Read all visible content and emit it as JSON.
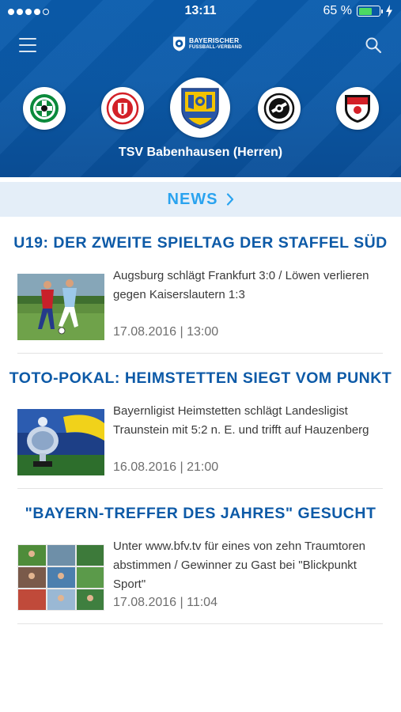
{
  "status_bar": {
    "time": "13:11",
    "battery_text": "65 %",
    "battery_level": 0.65,
    "signal_dots": 5,
    "signal_filled": 4
  },
  "header": {
    "logo_line1": "BAYERISCHER",
    "logo_line2": "FUSSBALL-VERBAND",
    "menu_icon": "hamburger-menu-icon",
    "search_icon": "search-icon",
    "selected_team": "TSV Babenhausen (Herren)",
    "colors": {
      "background": "#0a56a3",
      "text": "#ffffff"
    }
  },
  "club_crests": [
    {
      "icon": "green-club-crest-icon",
      "colors": [
        "#0b8a3b",
        "#ffffff"
      ]
    },
    {
      "icon": "red-club-crest-icon",
      "colors": [
        "#d32027",
        "#ffffff"
      ]
    },
    {
      "icon": "tsv-babenhausen-crest-icon",
      "colors": [
        "#2a56a7",
        "#f3c300"
      ],
      "selected": true
    },
    {
      "icon": "black-white-club-crest-icon",
      "colors": [
        "#111111",
        "#ffffff"
      ]
    },
    {
      "icon": "red-black-club-crest-icon",
      "colors": [
        "#d32027",
        "#111111"
      ]
    }
  ],
  "news_section": {
    "label": "NEWS",
    "chevron_icon": "chevron-right-icon",
    "colors": {
      "label": "#2aa3ef",
      "bar": "#e4eef8"
    }
  },
  "articles": [
    {
      "headline": "U19: DER ZWEITE SPIELTAG DER STAFFEL SÜD",
      "teaser": "Augsburg schlägt Frankfurt 3:0 / Löwen verlieren gegen Kaiserslautern 1:3",
      "date": "17.08.2016 | 13:00",
      "thumbnail": "soccer-match-photo"
    },
    {
      "headline": "TOTO-POKAL: HEIMSTETTEN SIEGT VOM PUNKT",
      "teaser": "Bayernligist Heimstetten schlägt Landesligist Traunstein mit 5:2 n. E. und trifft auf Hauzenberg",
      "date": "16.08.2016 | 21:00",
      "thumbnail": "trophy-photo"
    },
    {
      "headline": "\"BAYERN-TREFFER DES JAHRES\" GESUCHT",
      "teaser": "Unter www.bfv.tv für eines von zehn Traumtoren abstimmen / Gewinner zu Gast bei \"Blickpunkt Sport\"",
      "date": "17.08.2016 | 11:04",
      "thumbnail": "video-collage-photo"
    }
  ],
  "colors": {
    "headline": "#0d5aa7",
    "teaser": "#3a3a3a",
    "date": "#6e6e6e"
  }
}
